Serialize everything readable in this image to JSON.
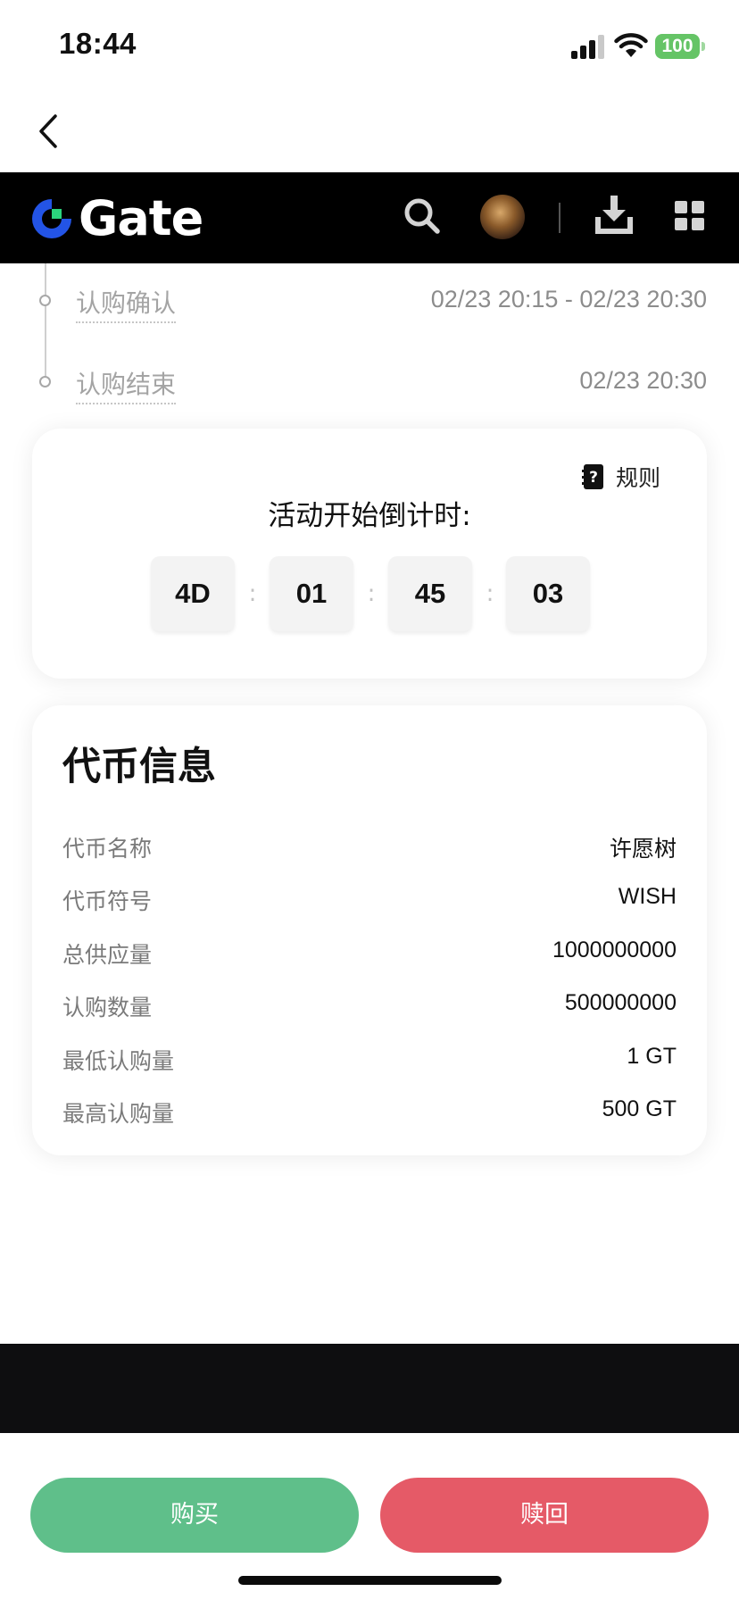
{
  "status_bar": {
    "time": "18:44",
    "battery": "100",
    "icons": [
      "signal-icon",
      "wifi-icon",
      "battery-icon"
    ]
  },
  "nav": {
    "back_icon": "chevron-left-icon"
  },
  "header": {
    "logo_text": "Gate",
    "icons": [
      "search-icon",
      "avatar",
      "download-icon",
      "grid-icon"
    ]
  },
  "timeline": {
    "items": [
      {
        "label": "认购确认",
        "time": "02/23 20:15 - 02/23 20:30"
      },
      {
        "label": "认购结束",
        "time": "02/23 20:30"
      }
    ]
  },
  "countdown": {
    "rules_label": "规则",
    "title": "活动开始倒计时:",
    "days": "4D",
    "hours": "01",
    "minutes": "45",
    "seconds": "03",
    "separator": ":"
  },
  "token_info": {
    "title": "代币信息",
    "rows": [
      {
        "label": "代币名称",
        "value": "许愿树"
      },
      {
        "label": "代币符号",
        "value": "WISH"
      },
      {
        "label": "总供应量",
        "value": "1000000000"
      },
      {
        "label": "认购数量",
        "value": "500000000"
      },
      {
        "label": "最低认购量",
        "value": "1 GT"
      },
      {
        "label": "最高认购量",
        "value": "500 GT"
      }
    ]
  },
  "actions": {
    "buy_label": "购买",
    "redeem_label": "赎回"
  },
  "colors": {
    "buy": "#5fbf8a",
    "redeem": "#e55a67",
    "header_bg": "#000000",
    "battery": "#65c466",
    "logo_blue": "#2354e6",
    "logo_green": "#2bd47d"
  }
}
